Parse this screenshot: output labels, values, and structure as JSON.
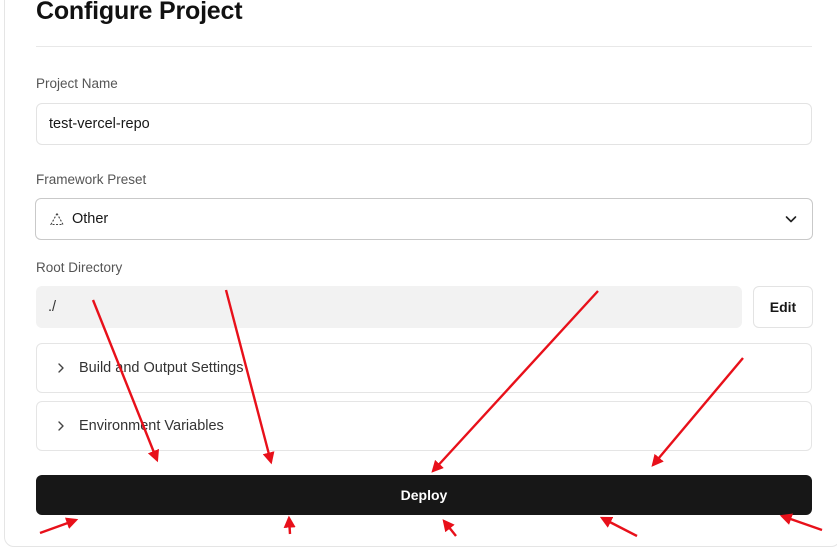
{
  "page": {
    "title": "Configure Project"
  },
  "project_name": {
    "label": "Project Name",
    "value": "test-vercel-repo"
  },
  "framework_preset": {
    "label": "Framework Preset",
    "selected": "Other",
    "icon": "triangle-icon"
  },
  "root_directory": {
    "label": "Root Directory",
    "value": "./",
    "edit_label": "Edit"
  },
  "sections": [
    {
      "label": "Build and Output Settings",
      "icon": "chevron-right-icon"
    },
    {
      "label": "Environment Variables",
      "icon": "chevron-right-icon"
    }
  ],
  "deploy": {
    "label": "Deploy"
  },
  "colors": {
    "annotation_arrow": "#e8101a",
    "deploy_bg": "#171717"
  }
}
